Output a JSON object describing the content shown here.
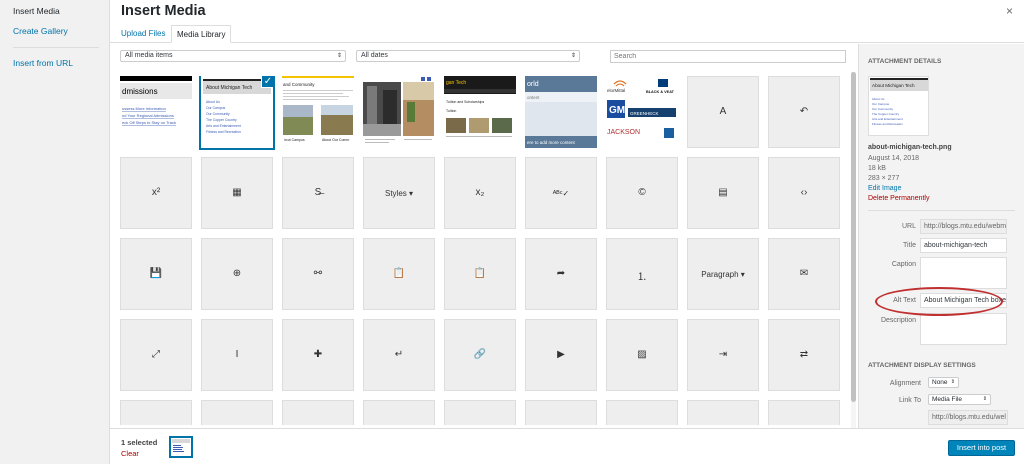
{
  "menu": {
    "insert_media": "Insert Media",
    "create_gallery": "Create Gallery",
    "insert_from_url": "Insert from URL"
  },
  "modal": {
    "title": "Insert Media",
    "close_icon": "×"
  },
  "tabs": {
    "upload": "Upload Files",
    "library": "Media Library"
  },
  "toolbar": {
    "media_filter": "All media items",
    "date_filter": "All dates",
    "search_placeholder": "Search"
  },
  "thumbs": {
    "admissions": {
      "title": "dmissions",
      "links": [
        "ussess More Information",
        "nd Your Regional Admissions",
        "eck Off Steps to Stay on Track"
      ]
    },
    "about_mt": {
      "title": "About Michigan Tech",
      "links": [
        "About Us",
        "Our Campus",
        "Our Community",
        "The Copper Country",
        "Arts and Entertainment",
        "Fitness and Recreation"
      ]
    },
    "community": {
      "title": "and Community",
      "cap1": "ircut Campus",
      "cap2": "About Our Comm"
    },
    "tech": {
      "header": "gan Tech",
      "l1": "Tuition and Scholarships",
      "l2": "Tuition"
    },
    "world": {
      "header": "orld",
      "content": "ontent",
      "footer": "ere to add more content"
    },
    "logos": {
      "l1": "elorMittal",
      "l2": "BLACK & VEAT",
      "l3": "GM",
      "l4": "GREENHECK",
      "l5": "JACKSON"
    }
  },
  "grid_icons": [
    {
      "name": "text-color-icon",
      "glyph": "A"
    },
    {
      "name": "undo-icon",
      "glyph": "↶"
    },
    {
      "name": "superscript-icon",
      "glyph": "x²"
    },
    {
      "name": "table-icon",
      "glyph": "▦"
    },
    {
      "name": "strikethrough-icon",
      "glyph": "S̶"
    },
    {
      "name": "styles-dropdown",
      "glyph": "Styles ▾"
    },
    {
      "name": "subscript-icon",
      "glyph": "x₂"
    },
    {
      "name": "spellcheck-icon",
      "glyph": "ᴬᴮᶜ✓"
    },
    {
      "name": "copyright-icon",
      "glyph": "©"
    },
    {
      "name": "page-break-icon",
      "glyph": "▤"
    },
    {
      "name": "code-icon",
      "glyph": "‹›"
    },
    {
      "name": "save-icon",
      "glyph": "💾"
    },
    {
      "name": "help-icon",
      "glyph": "⊕"
    },
    {
      "name": "unlink-icon",
      "glyph": "⚯"
    },
    {
      "name": "paste-icon",
      "glyph": "📋"
    },
    {
      "name": "paste-word-icon",
      "glyph": "📋"
    },
    {
      "name": "redo-icon",
      "glyph": "➦"
    },
    {
      "name": "numbered-list-icon",
      "glyph": "⒈"
    },
    {
      "name": "paragraph-dropdown",
      "glyph": "Paragraph ▾"
    },
    {
      "name": "email-icon",
      "glyph": "✉"
    },
    {
      "name": "fullscreen-icon",
      "glyph": "⤢"
    },
    {
      "name": "italic-icon",
      "glyph": "I"
    },
    {
      "name": "plugin-icon",
      "glyph": "✚"
    },
    {
      "name": "enter-icon",
      "glyph": "↵"
    },
    {
      "name": "link-icon",
      "glyph": "🔗"
    },
    {
      "name": "video-icon",
      "glyph": "▶"
    },
    {
      "name": "image-icon",
      "glyph": "▨"
    },
    {
      "name": "indent-icon",
      "glyph": "⇥"
    },
    {
      "name": "swap-icon",
      "glyph": "⇄"
    }
  ],
  "details": {
    "heading": "Attachment Details",
    "filename": "about-michigan-tech.png",
    "date": "August 14, 2018",
    "size": "18 kB",
    "dims": "283 × 277",
    "edit_image": "Edit Image",
    "delete": "Delete Permanently",
    "url_label": "URL",
    "url_value": "http://blogs.mtu.edu/webm",
    "title_label": "Title",
    "title_value": "about-michigan-tech",
    "caption_label": "Caption",
    "alt_label": "Alt Text",
    "alt_value": "About Michigan Tech boxe",
    "description_label": "Description"
  },
  "display": {
    "heading": "Attachment Display Settings",
    "alignment_label": "Alignment",
    "alignment_value": "None",
    "linkto_label": "Link To",
    "linkto_value": "Media File",
    "link_url": "http://blogs.mtu.edu/wel"
  },
  "bottom": {
    "selected": "1 selected",
    "clear": "Clear",
    "insert": "Insert into post"
  },
  "colors": {
    "accent": "#0073aa",
    "button": "#0085ba",
    "danger": "#a00",
    "annotation": "#c03030"
  }
}
